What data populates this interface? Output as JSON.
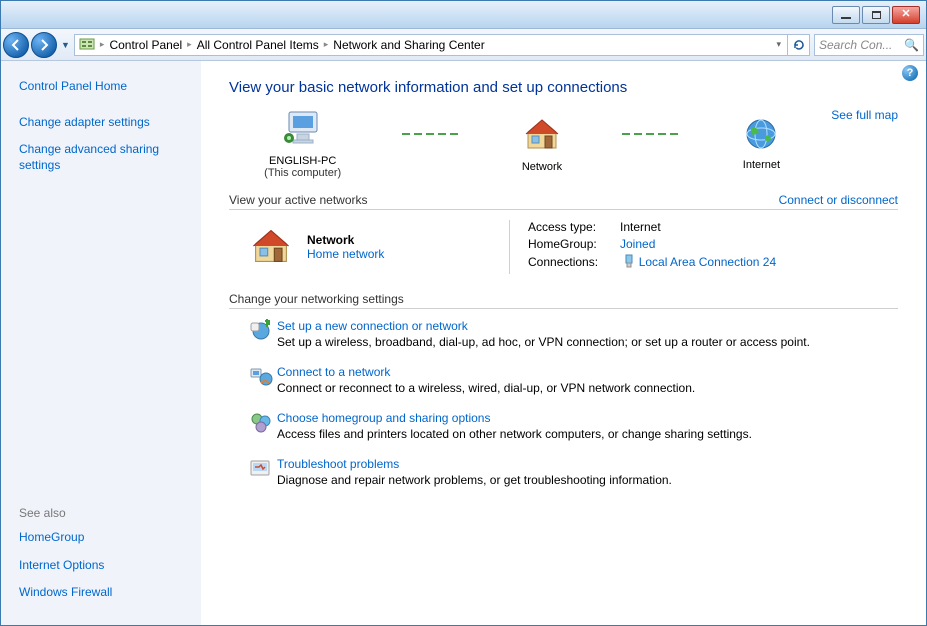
{
  "titlebar": {},
  "nav": {
    "breadcrumb": [
      "Control Panel",
      "All Control Panel Items",
      "Network and Sharing Center"
    ],
    "search_placeholder": "Search Con..."
  },
  "sidebar": {
    "home": "Control Panel Home",
    "links": [
      "Change adapter settings",
      "Change advanced sharing settings"
    ],
    "seealso_title": "See also",
    "seealso": [
      "HomeGroup",
      "Internet Options",
      "Windows Firewall"
    ]
  },
  "main": {
    "title": "View your basic network information and set up connections",
    "map": {
      "node1": {
        "label": "ENGLISH-PC",
        "sub": "(This computer)"
      },
      "node2": {
        "label": "Network"
      },
      "node3": {
        "label": "Internet"
      },
      "full_map": "See full map"
    },
    "active_label": "View your active networks",
    "connect_disconnect": "Connect or disconnect",
    "active": {
      "name": "Network",
      "type": "Home network",
      "access_k": "Access type:",
      "access_v": "Internet",
      "homegroup_k": "HomeGroup:",
      "homegroup_v": "Joined",
      "conn_k": "Connections:",
      "conn_v": "Local Area Connection 24"
    },
    "change_label": "Change your networking settings",
    "tasks": [
      {
        "title": "Set up a new connection or network",
        "desc": "Set up a wireless, broadband, dial-up, ad hoc, or VPN connection; or set up a router or access point."
      },
      {
        "title": "Connect to a network",
        "desc": "Connect or reconnect to a wireless, wired, dial-up, or VPN network connection."
      },
      {
        "title": "Choose homegroup and sharing options",
        "desc": "Access files and printers located on other network computers, or change sharing settings."
      },
      {
        "title": "Troubleshoot problems",
        "desc": "Diagnose and repair network problems, or get troubleshooting information."
      }
    ]
  }
}
